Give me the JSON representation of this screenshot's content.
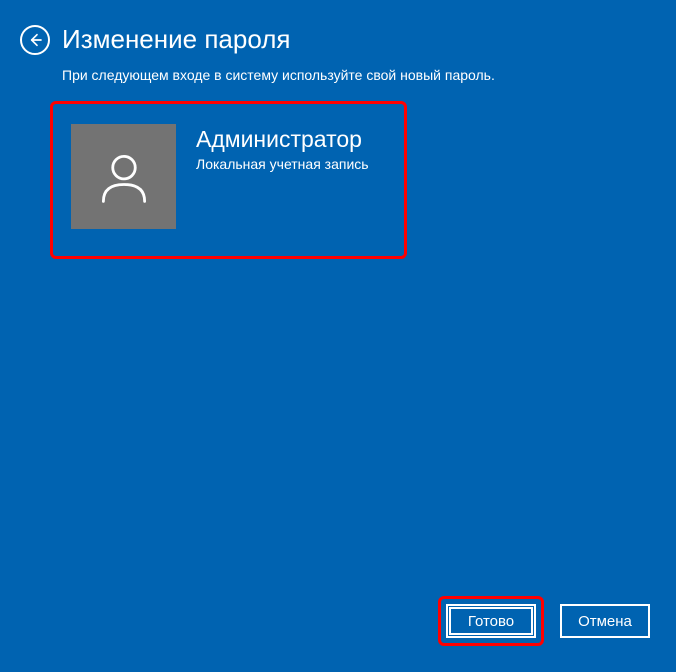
{
  "header": {
    "title": "Изменение пароля",
    "subtitle": "При следующем входе в систему используйте свой новый пароль."
  },
  "user": {
    "name": "Администратор",
    "account_type": "Локальная учетная запись"
  },
  "footer": {
    "done_label": "Готово",
    "cancel_label": "Отмена"
  }
}
